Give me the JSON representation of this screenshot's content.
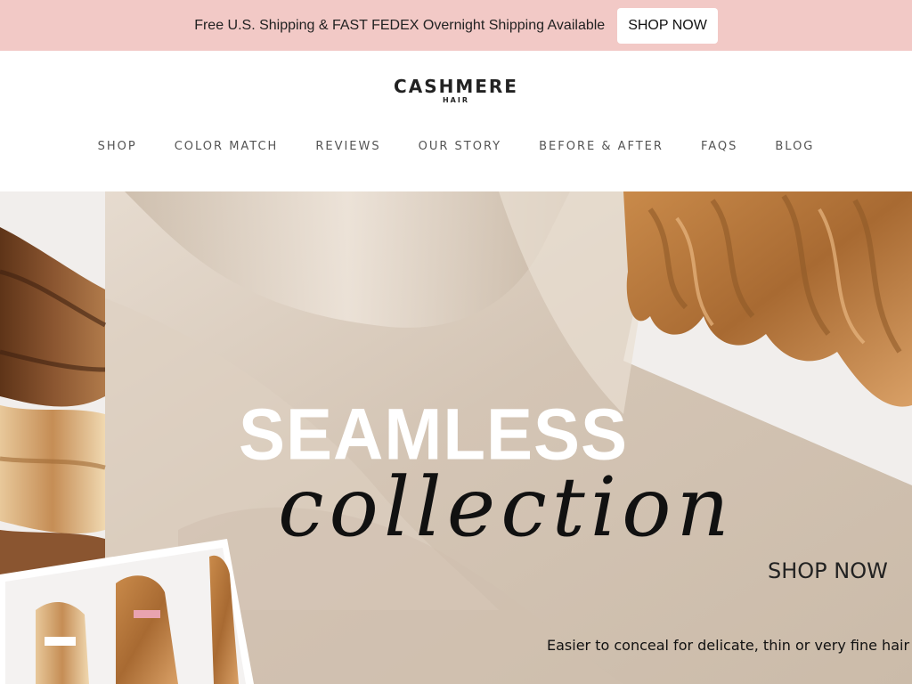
{
  "announcement": {
    "text": "Free U.S. Shipping & FAST FEDEX Overnight Shipping Available",
    "button_label": "SHOP NOW"
  },
  "header": {
    "logo_main": "CASHMERE",
    "logo_sub": "HAIR"
  },
  "nav": {
    "items": [
      "SHOP",
      "COLOR MATCH",
      "REVIEWS",
      "OUR STORY",
      "BEFORE & AFTER",
      "FAQS",
      "BLOG"
    ]
  },
  "hero": {
    "title": "SEAMLESS",
    "script": "collection",
    "shop_label": "SHOP NOW",
    "tagline": "Easier to conceal for delicate, thin or very fine hair"
  },
  "colors": {
    "announcement_bg": "#f2c9c6",
    "silk": "#d8cbbd",
    "hair_blonde": "#b57a3d",
    "hair_brown": "#7a4a26"
  }
}
